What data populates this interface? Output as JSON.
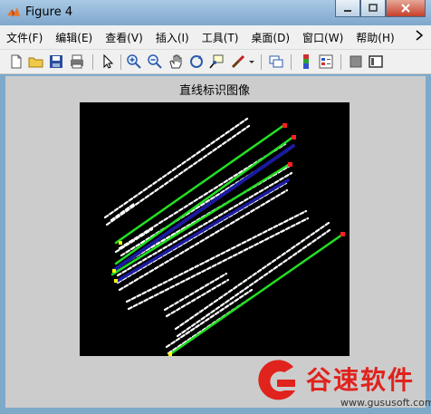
{
  "window": {
    "title": "Figure 4",
    "min_icon": "minimize-icon",
    "max_icon": "maximize-icon",
    "close_icon": "close-icon"
  },
  "menu": [
    "文件(F)",
    "编辑(E)",
    "查看(V)",
    "插入(I)",
    "工具(T)",
    "桌面(D)",
    "窗口(W)",
    "帮助(H)"
  ],
  "toolbar_icons": [
    "new-figure-icon",
    "open-file-icon",
    "save-icon",
    "print-icon",
    "pointer-icon",
    "zoom-in-icon",
    "zoom-out-icon",
    "pan-icon",
    "rotate-3d-icon",
    "data-cursor-icon",
    "brush-icon",
    "link-plot-icon",
    "colorbar-icon",
    "legend-icon",
    "hide-plot-tools-icon",
    "show-plot-tools-icon"
  ],
  "figure": {
    "title": "直线标识图像"
  },
  "watermark": {
    "text": "谷速软件",
    "url": "www.gususoft.com",
    "color": "#e0231d"
  },
  "colors": {
    "line_green": "#22e022",
    "line_blue": "#1a1aa0",
    "start_marker": "#ffff00",
    "end_marker": "#ff2020"
  }
}
